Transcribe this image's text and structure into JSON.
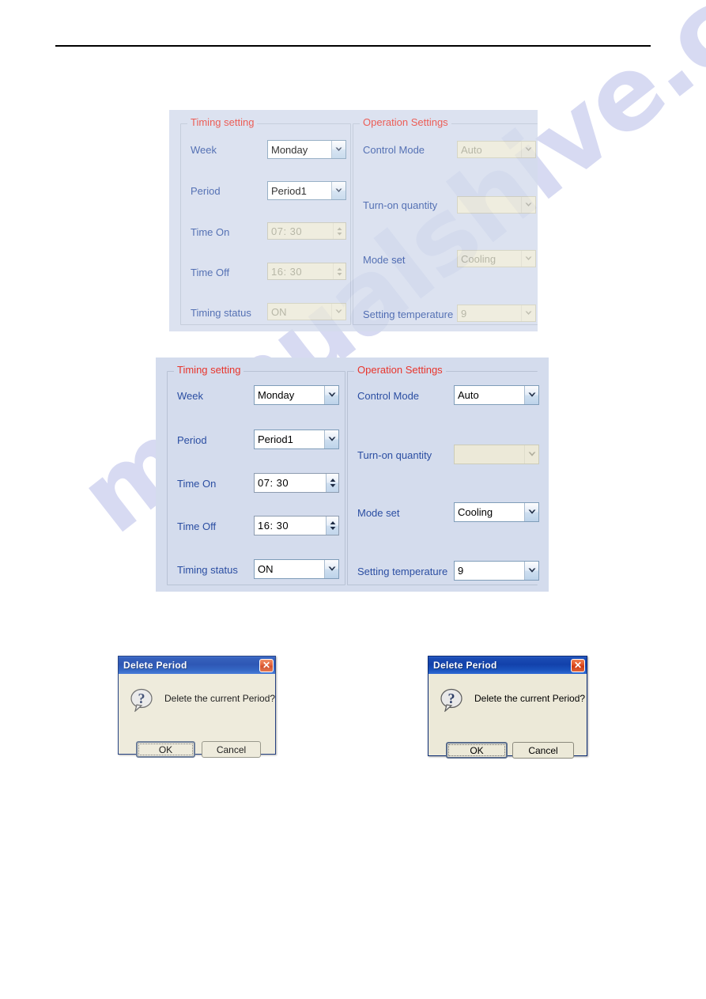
{
  "page": {
    "header_rule": true
  },
  "watermark": {
    "text": "manualshive.com"
  },
  "panel_disabled": {
    "timing_group": {
      "title": "Timing setting",
      "fields": [
        {
          "label": "Week",
          "value": "Monday",
          "control": "combo",
          "enabled": true
        },
        {
          "label": "Period",
          "value": "Period1",
          "control": "combo",
          "enabled": true
        },
        {
          "label": "Time On",
          "value": "07:  30",
          "control": "spinner",
          "enabled": false
        },
        {
          "label": "Time Off",
          "value": "16:  30",
          "control": "spinner",
          "enabled": false
        },
        {
          "label": "Timing status",
          "value": "ON",
          "control": "combo",
          "enabled": false
        }
      ]
    },
    "operation_group": {
      "title": "Operation Settings",
      "fields": [
        {
          "label": "Control Mode",
          "value": "Auto",
          "control": "combo",
          "enabled": false
        },
        {
          "label": "Turn-on quantity",
          "value": "",
          "control": "combo",
          "enabled": false
        },
        {
          "label": "Mode set",
          "value": "Cooling",
          "control": "combo",
          "enabled": false
        },
        {
          "label": "Setting temperature",
          "value": "9",
          "control": "combo",
          "enabled": false
        }
      ]
    }
  },
  "panel_enabled": {
    "timing_group": {
      "title": "Timing setting",
      "fields": [
        {
          "label": "Week",
          "value": "Monday",
          "control": "combo",
          "enabled": true
        },
        {
          "label": "Period",
          "value": "Period1",
          "control": "combo",
          "enabled": true
        },
        {
          "label": "Time On",
          "value": "07:  30",
          "control": "spinner",
          "enabled": true
        },
        {
          "label": "Time Off",
          "value": "16:  30",
          "control": "spinner",
          "enabled": true
        },
        {
          "label": "Timing status",
          "value": "ON",
          "control": "combo",
          "enabled": true
        }
      ]
    },
    "operation_group": {
      "title": "Operation Settings",
      "fields": [
        {
          "label": "Control Mode",
          "value": "Auto",
          "control": "combo",
          "enabled": true
        },
        {
          "label": "Turn-on quantity",
          "value": "",
          "control": "combo",
          "enabled": false
        },
        {
          "label": "Mode set",
          "value": "Cooling",
          "control": "combo",
          "enabled": true
        },
        {
          "label": "Setting temperature",
          "value": "9",
          "control": "combo",
          "enabled": true
        }
      ]
    }
  },
  "dialog_left": {
    "title": "Delete Period",
    "close_label": "✕",
    "message": "Delete the current Period?",
    "ok_label": "OK",
    "cancel_label": "Cancel"
  },
  "dialog_right": {
    "title": "Delete Period",
    "close_label": "✕",
    "message": "Delete the current Period?",
    "ok_label": "OK",
    "cancel_label": "Cancel"
  },
  "colors": {
    "panel_bg": "#d4dced",
    "group_title": "#e8352c",
    "field_label": "#2b4ea2",
    "disabled_field_bg": "#ece9d8",
    "dialog_title_bg": "#1241ab",
    "close_button": "#cc3a12",
    "watermark": "#c9cdee"
  }
}
